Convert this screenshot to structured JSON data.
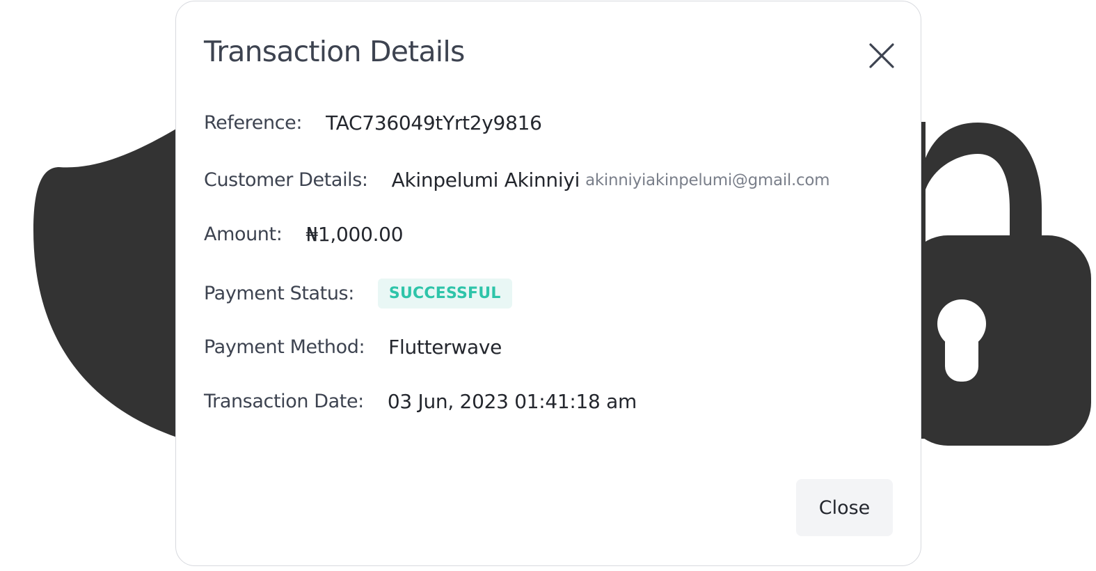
{
  "modal": {
    "title": "Transaction Details",
    "close_button_label": "Close"
  },
  "details": {
    "reference": {
      "label": "Reference:",
      "value": "TAC736049tYrt2y9816"
    },
    "customer": {
      "label": "Customer Details:",
      "name": "Akinpelumi Akinniyi",
      "email": "akinniyiakinpelumi@gmail.com"
    },
    "amount": {
      "label": "Amount:",
      "value": "₦1,000.00"
    },
    "payment_status": {
      "label": "Payment Status:",
      "value": "SUCCESSFUL"
    },
    "payment_method": {
      "label": "Payment Method:",
      "value": "Flutterwave"
    },
    "transaction_date": {
      "label": "Transaction Date:",
      "value": "03 Jun, 2023 01:41:18 am"
    }
  },
  "colors": {
    "background_shape": "#333333",
    "status_success_text": "#2ec4a9",
    "status_success_bg": "#e9f7f5"
  },
  "icons": {
    "close": "close-icon",
    "background": "shield-lock-icon"
  }
}
